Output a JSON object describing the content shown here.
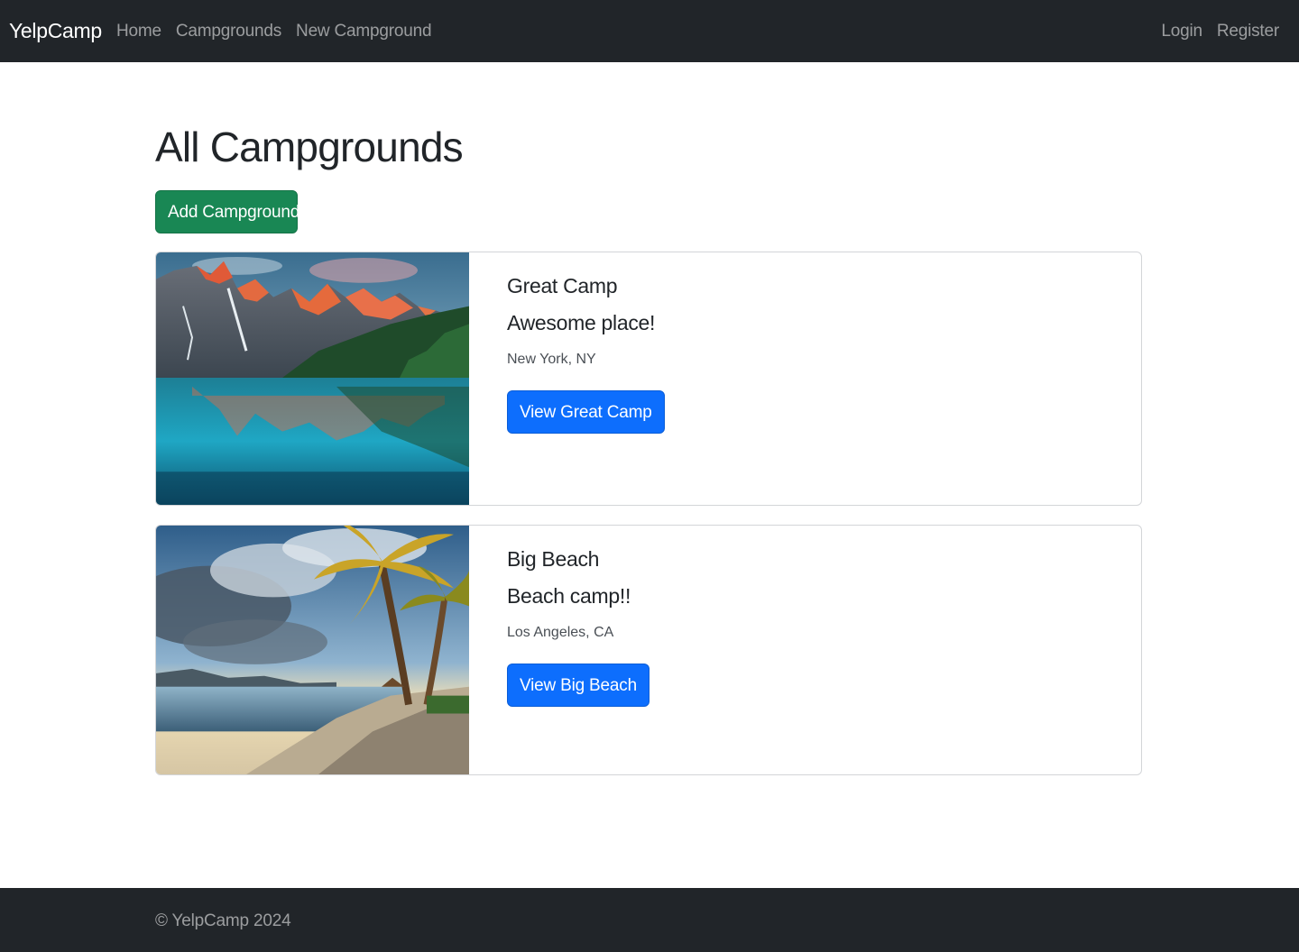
{
  "navbar": {
    "brand": "YelpCamp",
    "left_links": [
      "Home",
      "Campgrounds",
      "New Campground"
    ],
    "right_links": [
      "Login",
      "Register"
    ],
    "background_color": "#212529"
  },
  "main": {
    "title": "All Campgrounds",
    "add_button_label": "Add Campground",
    "add_button_color": "#198754"
  },
  "campgrounds": [
    {
      "title": "Great Camp",
      "description": "Awesome place!",
      "location": "New York, NY",
      "button_label": "View Great Camp",
      "image": "mountain-lake-photo"
    },
    {
      "title": "Big Beach",
      "description": "Beach camp!!",
      "location": "Los Angeles, CA",
      "button_label": "View Big Beach",
      "image": "palm-beach-photo"
    }
  ],
  "footer": {
    "text": "© YelpCamp 2024"
  },
  "colors": {
    "primary": "#0d6efd",
    "success": "#198754",
    "dark": "#212529"
  }
}
